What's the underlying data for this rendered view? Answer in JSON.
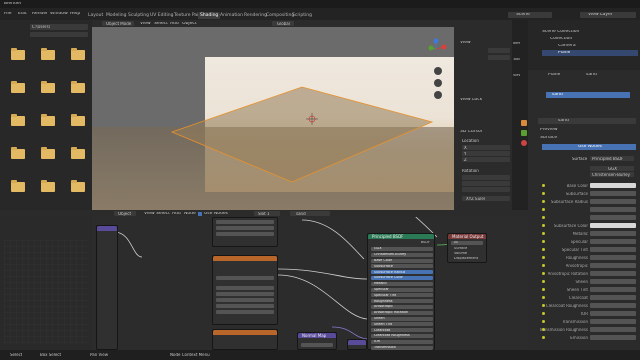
{
  "app": {
    "title": "Blender",
    "menus": [
      "File",
      "Edit",
      "Render",
      "Window",
      "Help"
    ]
  },
  "workspace_tabs": [
    "Layout",
    "Modeling",
    "Sculpting",
    "UV Editing",
    "Texture Paint",
    "Shading",
    "Animation",
    "Rendering",
    "Compositing",
    "Scripting"
  ],
  "active_tab": "Shading",
  "scene": {
    "scene_label": "Scene",
    "layer_label": "View Layer"
  },
  "file_browser": {
    "path": "C:\\Users\\",
    "folders": [
      {
        "label": ""
      },
      {
        "label": ""
      },
      {
        "label": ""
      },
      {
        "label": ""
      },
      {
        "label": ""
      },
      {
        "label": ""
      },
      {
        "label": ""
      },
      {
        "label": ""
      },
      {
        "label": ""
      },
      {
        "label": ""
      },
      {
        "label": ""
      },
      {
        "label": ""
      },
      {
        "label": ""
      },
      {
        "label": ""
      },
      {
        "label": ""
      }
    ]
  },
  "viewport": {
    "mode": "Object Mode",
    "menus": [
      "View",
      "Select",
      "Add",
      "Object"
    ],
    "transform": "Global",
    "info_line1": "",
    "info_line2": ""
  },
  "npanel": {
    "tabs": [
      "Item",
      "Tool",
      "View"
    ],
    "view_section": "View",
    "clip_start_label": "",
    "clip_start": "",
    "clip_end_label": "",
    "clip_end": "",
    "local_camera_label": "",
    "render_region_label": "",
    "view_lock_label": "View Lock",
    "lock_label": "",
    "lock_camera_label": "",
    "cursor_section": "3D Cursor",
    "location_label": "Location",
    "x_label": "X",
    "y_label": "Y",
    "z_label": "Z",
    "rotation_label": "Rotation",
    "rot_mode": "XYZ Euler"
  },
  "outliner": {
    "items": [
      {
        "label": "Scene Collection"
      },
      {
        "label": "Collection"
      },
      {
        "label": "Camera"
      },
      {
        "label": "Plane"
      }
    ]
  },
  "properties": {
    "object": "Plane",
    "material": "sand",
    "slot_label": "sand",
    "preview_label": "Preview",
    "surface_label": "Surface",
    "use_nodes_label": "Use Nodes",
    "surface_value": "Principled BSDF",
    "dist": "GGX",
    "ss_method": "Christensen-Burley",
    "rows": [
      {
        "label": "Base Color",
        "value": ""
      },
      {
        "label": "Subsurface",
        "value": ""
      },
      {
        "label": "Subsurface Radius",
        "value": ""
      },
      {
        "label": "",
        "value": ""
      },
      {
        "label": "",
        "value": ""
      },
      {
        "label": "Subsurface Color",
        "value": ""
      },
      {
        "label": "Metallic",
        "value": ""
      },
      {
        "label": "Specular",
        "value": ""
      },
      {
        "label": "Specular Tint",
        "value": ""
      },
      {
        "label": "Roughness",
        "value": ""
      },
      {
        "label": "Anisotropic",
        "value": ""
      },
      {
        "label": "Anisotropic Rotation",
        "value": ""
      },
      {
        "label": "Sheen",
        "value": ""
      },
      {
        "label": "Sheen Tint",
        "value": ""
      },
      {
        "label": "Clearcoat",
        "value": ""
      },
      {
        "label": "Clearcoat Roughness",
        "value": ""
      },
      {
        "label": "IOR",
        "value": ""
      },
      {
        "label": "Transmission",
        "value": ""
      },
      {
        "label": "Transmission Roughness",
        "value": ""
      },
      {
        "label": "Emission",
        "value": ""
      }
    ]
  },
  "node_editor": {
    "menus": [
      "Object",
      "View",
      "Select",
      "Add",
      "Node"
    ],
    "use_nodes": "Use Nodes",
    "slot": "Slot 1",
    "material": "sand",
    "bsdf_title": "Principled BSDF",
    "bsdf_out": "BSDF",
    "output_title": "Material Output",
    "output_target": "All",
    "output_surface": "Surface",
    "output_volume": "Volume",
    "output_disp": "Displacement",
    "image_title": "",
    "image_name": "",
    "normal_title": "Normal Map",
    "strength_label": "Strength",
    "bsdf_rows": [
      {
        "label": "GGX"
      },
      {
        "label": "Christensen-Burley"
      },
      {
        "label": "Base Color"
      },
      {
        "label": "Subsurface",
        "value": ""
      },
      {
        "label": "Subsurface Radius"
      },
      {
        "label": "Subsurface Color"
      },
      {
        "label": "Metallic",
        "value": ""
      },
      {
        "label": "Specular",
        "value": ""
      },
      {
        "label": "Specular Tint",
        "value": ""
      },
      {
        "label": "Roughness",
        "value": ""
      },
      {
        "label": "Anisotropic",
        "value": ""
      },
      {
        "label": "Anisotropic Rotation",
        "value": ""
      },
      {
        "label": "Sheen",
        "value": ""
      },
      {
        "label": "Sheen Tint",
        "value": ""
      },
      {
        "label": "Clearcoat",
        "value": ""
      },
      {
        "label": "Clearcoat Roughness",
        "value": ""
      },
      {
        "label": "IOR",
        "value": ""
      },
      {
        "label": "Transmission",
        "value": ""
      }
    ]
  },
  "status": {
    "select_label": "Select",
    "box_label": "Box Select",
    "pan_label": "Pan View",
    "context_label": "Node Context Menu",
    "stats": ""
  },
  "colors": {
    "accent": "#4772b3",
    "output_header": "#7a3a3a",
    "bsdf_header": "#2a7a55",
    "texture_header": "#b8662a",
    "vector_header": "#5a4a9a",
    "folder": "#e3b964"
  }
}
